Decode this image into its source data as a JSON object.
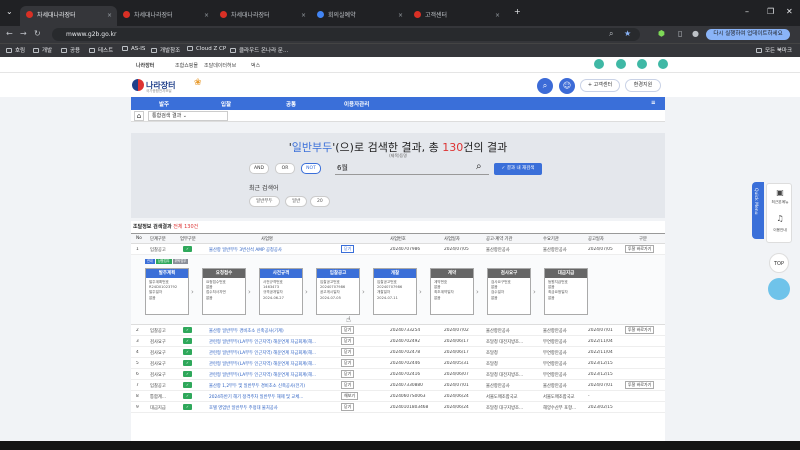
{
  "browser": {
    "tabs": [
      {
        "label": "차세대나라장터",
        "color": "#d93025"
      },
      {
        "label": "차세대나라장터",
        "color": "#d93025"
      },
      {
        "label": "차세대나라장터",
        "color": "#d93025"
      },
      {
        "label": "회의실예약",
        "color": "#4285f4"
      },
      {
        "label": "고객센터",
        "color": "#d93025"
      }
    ],
    "url": "mwww.g2b.go.kr",
    "relaunch": "다시 실행하여 업데이트하세요",
    "bookmarks": [
      "호림",
      "개발",
      "공용",
      "테스트",
      "AS-IS",
      "개발참조",
      "Cloud Z CP",
      "클라우드 온나라 문...",
      "모든 북마크"
    ]
  },
  "site": {
    "top_menu": [
      "나라장터",
      "조합쇼핑몰",
      "조달데이터허브",
      "벅스"
    ],
    "logo": "나라장터",
    "logo_sub": "국가종합전자조달",
    "support": "+ 고객센터",
    "env": "환경지원",
    "gnb": [
      "발주",
      "입찰",
      "공통",
      "이용자관리"
    ],
    "breadcrumb": "통합검색 결과"
  },
  "search": {
    "keyword": "일반부두",
    "prefix": "'",
    "mid": "'(으)로 검색한 결과, 총",
    "count": "130",
    "suffix": "건의 결과",
    "subnote": "(제목)등명",
    "ops": [
      "AND",
      "OR",
      "NOT"
    ],
    "input": "6월",
    "result_btn": "결과 내 재검색",
    "recent_label": "최근 검색어",
    "recent": [
      "일반부두",
      "일반",
      "20"
    ]
  },
  "results": {
    "title": "조달정보 검색결과",
    "total": "전체 130건",
    "headers": [
      "No",
      "단계구분",
      "업무구분",
      "사업명",
      "사업번호",
      "사업일자",
      "공고·계약 기관",
      "수요기관",
      "공고일자",
      "구분"
    ],
    "rows": [
      {
        "no": "1",
        "stage": "입찰공고",
        "name": "물산항 일반부두 3번선석 AMP 공청공사",
        "num": "20240707986",
        "date": "2024/07/05",
        "org": "울산항만공사",
        "demand": "울산항만공사",
        "pdate": "2024/07/05",
        "btn": "닫기",
        "extra": "투찰 바로가기"
      },
      {
        "no": "2",
        "stage": "입찰공고",
        "name": "울산항 일반부두 경비초소 신축공사(기계)",
        "num": "20240733254",
        "date": "2024/07/02",
        "org": "울산항만공사",
        "demand": "울산항만공사",
        "pdate": "2024/07/01",
        "btn": "닫기",
        "extra": "투찰 바로가기"
      },
      {
        "no": "3",
        "stage": "검사요구",
        "name": "관련형 일반부두(LA부두 인근지역) 해운연계 자금회계(해...",
        "num": "20240702492",
        "date": "2024/06/17",
        "org": "조달청 대전지방조...",
        "demand": "무연항만공사",
        "pdate": "2022/11/04",
        "btn": "닫기",
        "extra": ""
      },
      {
        "no": "4",
        "stage": "검사요구",
        "name": "관련형 일반부두(LA부두 인근지역) 해운연계 자금회계(해...",
        "num": "20240702478",
        "date": "2024/06/17",
        "org": "조달청",
        "demand": "무연항만공사",
        "pdate": "2022/11/04",
        "btn": "닫기",
        "extra": ""
      },
      {
        "no": "5",
        "stage": "검사요구",
        "name": "관련형 일반부두(LA부두 인근지역) 해운연계 자금회계(해...",
        "num": "20240702446",
        "date": "2024/05/31",
        "org": "조달청",
        "demand": "무연항만공사",
        "pdate": "2023/12/15",
        "btn": "닫기",
        "extra": ""
      },
      {
        "no": "6",
        "stage": "검사요구",
        "name": "관련형 일반부두(LA부두 인근지역) 해운연계 자금회계(해...",
        "num": "20240702416",
        "date": "2024/06/07",
        "org": "조달청 대전지방조...",
        "demand": "무연항만공사",
        "pdate": "2023/12/15",
        "btn": "닫기",
        "extra": ""
      },
      {
        "no": "7",
        "stage": "입찰공고",
        "name": "울산항 1,2부두 및 일반부두 경비초소 신축공사(전기)",
        "num": "202407330880",
        "date": "2024/07/01",
        "org": "울산항만공사",
        "demand": "울산항만공사",
        "pdate": "2024/07/01",
        "btn": "닫기",
        "extra": "투찰 바로가기"
      },
      {
        "no": "8",
        "stage": "통합계...",
        "name": "2024하반기 해기 정격주차 일반부두 해제 및 교체...",
        "num": "20240607S0063",
        "date": "2024/06/24",
        "org": "서울도매조합국교",
        "demand": "서울도매조합국교",
        "pdate": "-",
        "btn": "해보기",
        "extra": ""
      },
      {
        "no": "9",
        "stage": "대금지급",
        "name": "호텔 영업반 일반부두 주정대 물처공사",
        "num": "20240101803468",
        "date": "2024/06/24",
        "org": "조달청 대구지방조...",
        "demand": "해양수산부 포항...",
        "pdate": "2023/02/15",
        "btn": "닫기",
        "extra": ""
      }
    ],
    "detail": {
      "tags": [
        "관내",
        "상품업무",
        "위탁업무"
      ],
      "stages": [
        {
          "title": "발주계획",
          "color": "#3b6fd8",
          "lines": [
            "발주계획번호",
            "R24D01023792",
            "발주일자",
            "없음"
          ]
        },
        {
          "title": "요청접수",
          "color": "#666",
          "lines": [
            "요청접수번호",
            "없음",
            "접수처사자번",
            "없음"
          ]
        },
        {
          "title": "사전규격",
          "color": "#3b6fd8",
          "lines": [
            "사전규격번호",
            "1463473",
            "규격공개일자",
            "2024-06-27"
          ]
        },
        {
          "title": "입찰공고",
          "color": "#3b6fd8",
          "lines": [
            "입찰공고번호",
            "20240707986",
            "공고게시일자",
            "2024-07-05"
          ]
        },
        {
          "title": "개찰",
          "color": "#3b6fd8",
          "lines": [
            "입찰공고번호",
            "20240707986",
            "개찰일자",
            "2024-07-11"
          ]
        },
        {
          "title": "계약",
          "color": "#666",
          "lines": [
            "계약번호",
            "없음",
            "최초계약일자",
            "없음"
          ]
        },
        {
          "title": "검사요구",
          "color": "#666",
          "lines": [
            "검사요구번호",
            "없음",
            "검수일자",
            "없음"
          ]
        },
        {
          "title": "대금지급",
          "color": "#666",
          "lines": [
            "등원지급번호",
            "없음",
            "최금요청일자",
            "없음"
          ]
        }
      ]
    }
  },
  "side": {
    "quick": "Quick Menu",
    "items": [
      "최근본메뉴",
      "이용안내"
    ],
    "top": "TOP"
  }
}
